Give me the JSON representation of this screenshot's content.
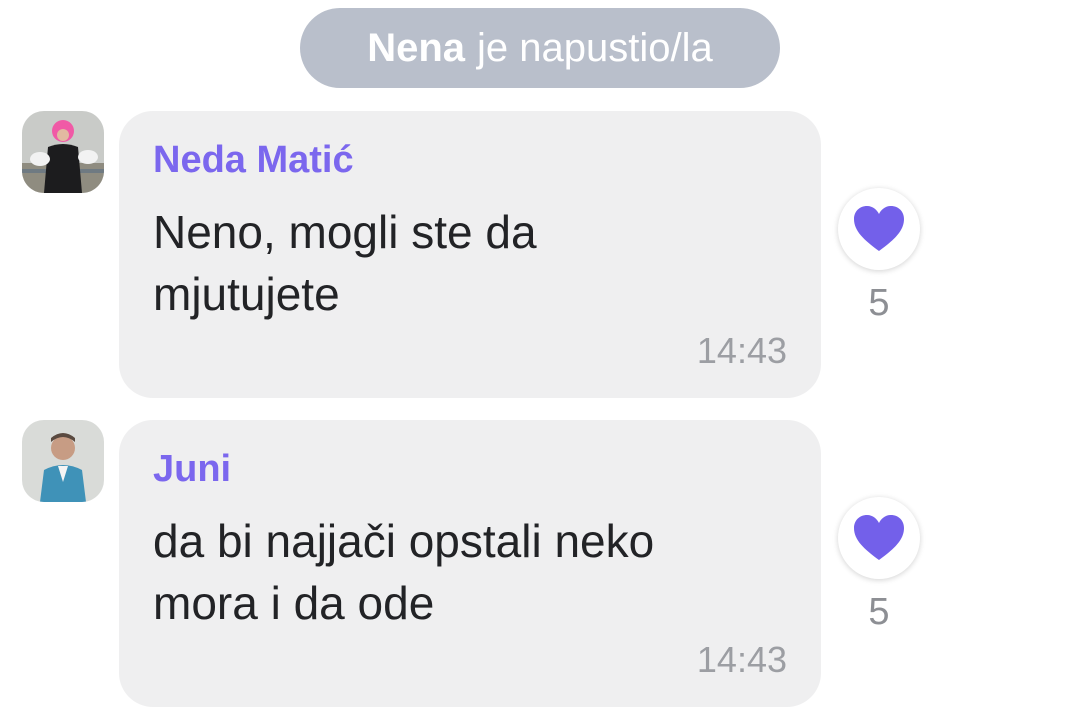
{
  "system_message": {
    "name": "Nena",
    "text": "je napustio/la"
  },
  "messages": [
    {
      "sender": "Neda Matić",
      "text": "Neno, mogli ste da\nmjutujete",
      "time": "14:43",
      "reaction": {
        "icon": "heart-icon",
        "count": "5"
      },
      "avatar": "avatar-neda"
    },
    {
      "sender": "Juni",
      "text": "da bi najjači opstali neko\nmora i da ode",
      "time": "14:43",
      "reaction": {
        "icon": "heart-icon",
        "count": "5"
      },
      "avatar": "avatar-juni"
    }
  ],
  "colors": {
    "accent": "#7b67ee",
    "bubble": "#efeff0",
    "system_pill": "#b9bfcb"
  }
}
